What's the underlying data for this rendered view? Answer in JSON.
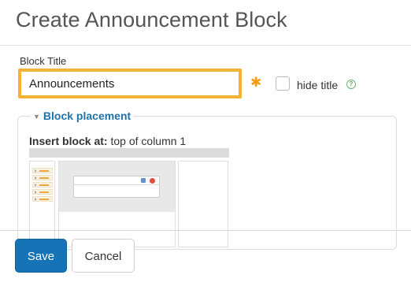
{
  "dialog": {
    "title": "Create Announcement Block"
  },
  "form": {
    "block_title_label": "Block Title",
    "block_title_value": "Announcements",
    "required_marker": "✱",
    "hide_title_label": "hide title",
    "hide_title_checked": false,
    "help_symbol": "?"
  },
  "placement": {
    "legend": "Block placement",
    "insert_prefix": "Insert block at:",
    "insert_value": "top of column 1"
  },
  "buttons": {
    "save": "Save",
    "cancel": "Cancel"
  },
  "colors": {
    "accent_blue": "#1573b6",
    "focus_orange": "#f5b335",
    "required_orange": "#f39c12",
    "legend_blue": "#1d73a9"
  },
  "icons": {
    "required": "asterisk-icon",
    "help": "help-icon",
    "collapse": "caret-down-icon"
  }
}
